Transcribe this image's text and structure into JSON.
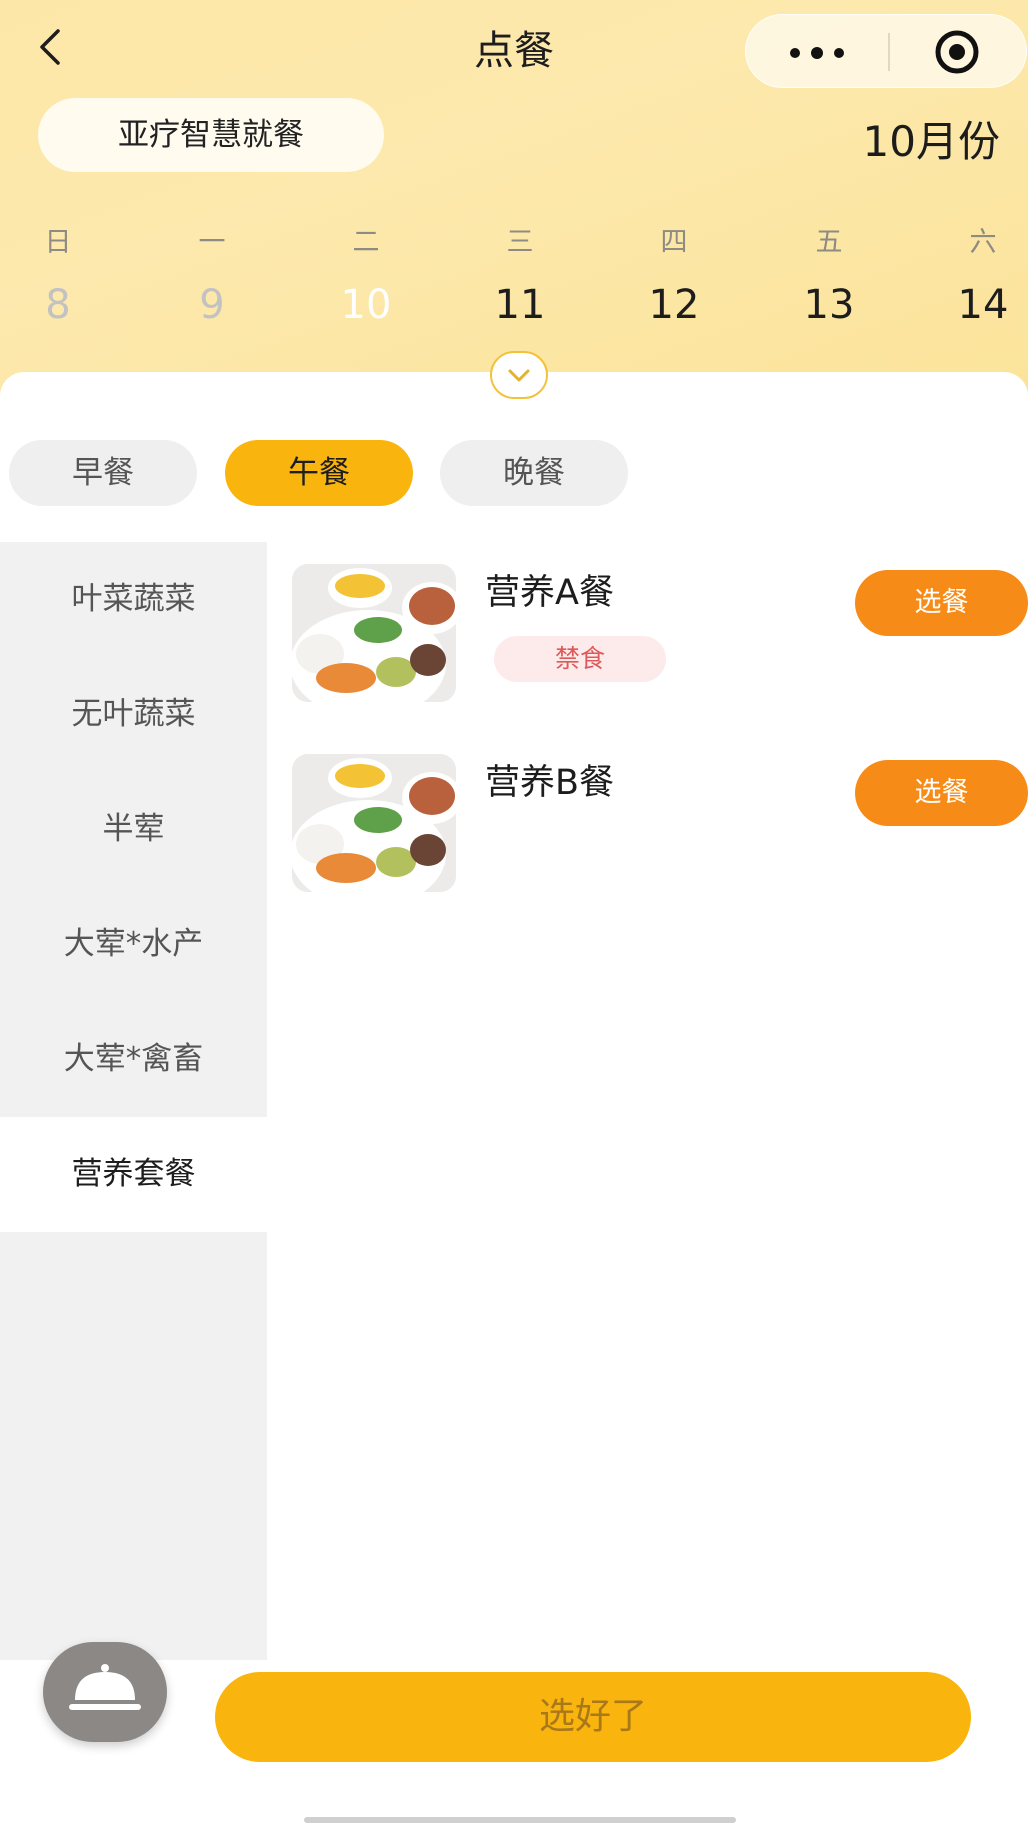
{
  "nav": {
    "title": "点餐",
    "back_icon": "chevron-left-icon",
    "more_icon": "more-dots-icon",
    "close_icon": "target-close-icon"
  },
  "header": {
    "canteen_name": "亚疗智慧就餐",
    "month_label": "10月份"
  },
  "calendar": {
    "weekdays": [
      "日",
      "一",
      "二",
      "三",
      "四",
      "五",
      "六"
    ],
    "dates": [
      "8",
      "9",
      "10",
      "11",
      "12",
      "13",
      "14"
    ],
    "selected_date": "10",
    "expand_icon": "chevron-down-icon"
  },
  "meal_tabs": [
    "早餐",
    "午餐",
    "晚餐"
  ],
  "selected_meal": "午餐",
  "categories": [
    "叶菜蔬菜",
    "无叶蔬菜",
    "半荤",
    "大荤*水产",
    "大荤*禽畜",
    "营养套餐"
  ],
  "selected_category": "营养套餐",
  "dishes": [
    {
      "name": "营养A餐",
      "tag": "禁食",
      "action": "选餐"
    },
    {
      "name": "营养B餐",
      "action": "选餐"
    }
  ],
  "footer": {
    "confirm_label": "选好了",
    "tray_icon": "food-cloche-icon"
  },
  "colors": {
    "accent": "#f9b50e",
    "select_button": "#f78b17",
    "tag_text": "#de5a5a",
    "tag_bg": "#fdeaea"
  }
}
